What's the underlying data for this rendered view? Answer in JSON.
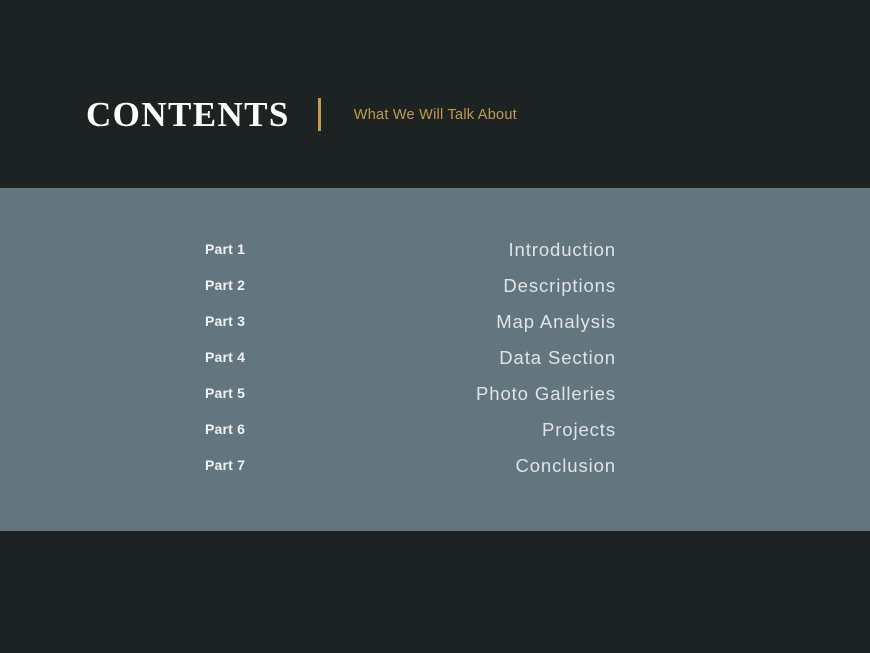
{
  "slide": {
    "background_dark": "#1d2322",
    "background_slate": "#63757f",
    "accent_gold": "#c49a4e"
  },
  "header": {
    "title": "CONTENTS",
    "divider": "vertical-rule",
    "subtitle": "What We Will Talk About"
  },
  "contents": {
    "rows": [
      {
        "part": "Part 1",
        "section": "Introduction"
      },
      {
        "part": "Part 2",
        "section": "Descriptions"
      },
      {
        "part": "Part 3",
        "section": "Map Analysis"
      },
      {
        "part": "Part 4",
        "section": "Data Section"
      },
      {
        "part": "Part 5",
        "section": "Photo Galleries"
      },
      {
        "part": "Part 6",
        "section": "Projects"
      },
      {
        "part": "Part 7",
        "section": "Conclusion"
      }
    ]
  }
}
